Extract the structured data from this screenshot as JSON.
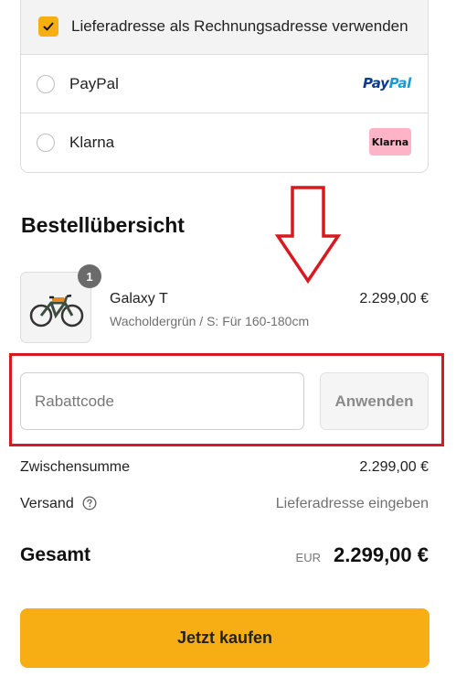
{
  "payment": {
    "billing_same_label": "Lieferadresse als Rechnungsadresse verwenden",
    "billing_same_checked": true,
    "options": [
      {
        "label": "PayPal",
        "logo_text_1": "Pay",
        "logo_text_2": "Pal",
        "selected": false
      },
      {
        "label": "Klarna",
        "logo_text": "Klarna",
        "selected": false
      }
    ]
  },
  "order": {
    "title": "Bestellübersicht",
    "item": {
      "quantity": "1",
      "name": "Galaxy T",
      "variant": "Wacholdergrün / S: Für 160-180cm",
      "price": "2.299,00 €"
    }
  },
  "discount": {
    "placeholder": "Rabattcode",
    "value": "",
    "apply_label": "Anwenden"
  },
  "summary": {
    "subtotal_label": "Zwischensumme",
    "subtotal_value": "2.299,00 €",
    "shipping_label": "Versand",
    "shipping_value": "Lieferadresse eingeben",
    "total_label": "Gesamt",
    "total_currency": "EUR",
    "total_value": "2.299,00 €"
  },
  "cta": {
    "buy_label": "Jetzt kaufen"
  },
  "colors": {
    "accent": "#f7ae15",
    "annotation_red": "#d71921",
    "paypal_dark": "#0d3a8a",
    "paypal_light": "#1b9ad6",
    "klarna_pink": "#ffb3c7"
  },
  "icons": [
    "checkmark-icon",
    "help-circle-icon",
    "bike-thumbnail",
    "down-arrow-annotation"
  ]
}
